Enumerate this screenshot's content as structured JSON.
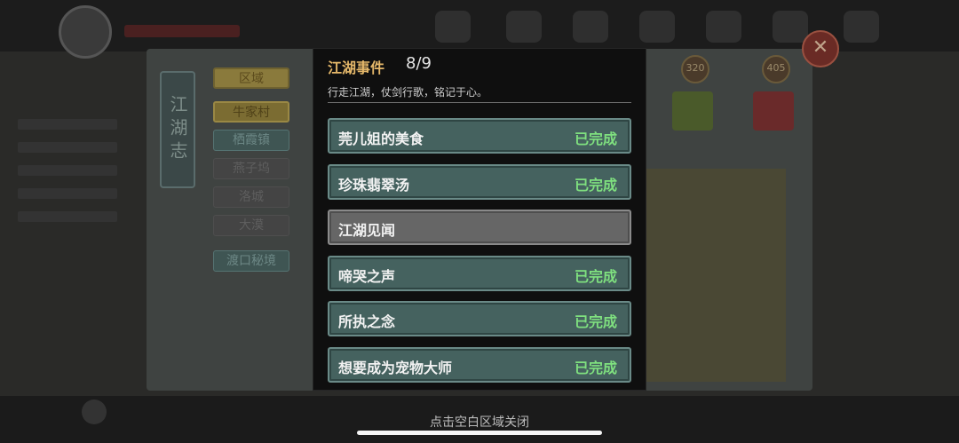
{
  "background": {
    "journal_spine": "江湖志",
    "regions": [
      {
        "label": "区域",
        "state": "header"
      },
      {
        "label": "牛家村",
        "state": "selected"
      },
      {
        "label": "栖霞镇",
        "state": "unlocked"
      },
      {
        "label": "燕子坞",
        "state": "locked"
      },
      {
        "label": "洛城",
        "state": "locked"
      },
      {
        "label": "大漠",
        "state": "locked"
      },
      {
        "label": "渡口秘境",
        "state": "unlocked"
      }
    ],
    "map_badges": [
      "320",
      "405"
    ]
  },
  "modal": {
    "title": "江湖事件",
    "count": "8/9",
    "subtitle": "行走江湖，仗剑行歌，铭记于心。",
    "events": [
      {
        "name": "莞儿姐的美食",
        "status": "已完成",
        "locked": false
      },
      {
        "name": "珍珠翡翠汤",
        "status": "已完成",
        "locked": false
      },
      {
        "name": "江湖见闻",
        "status": "",
        "locked": true
      },
      {
        "name": "啼哭之声",
        "status": "已完成",
        "locked": false
      },
      {
        "name": "所执之念",
        "status": "已完成",
        "locked": false
      },
      {
        "name": "想要成为宠物大师",
        "status": "已完成",
        "locked": false
      }
    ]
  },
  "footer": {
    "hint": "点击空白区域关闭"
  },
  "icons": {
    "close": "close-icon"
  },
  "colors": {
    "title_gold": "#e5b86a",
    "completed_green": "#7fe07f",
    "event_teal": "#45625f",
    "event_gray": "#666666"
  }
}
